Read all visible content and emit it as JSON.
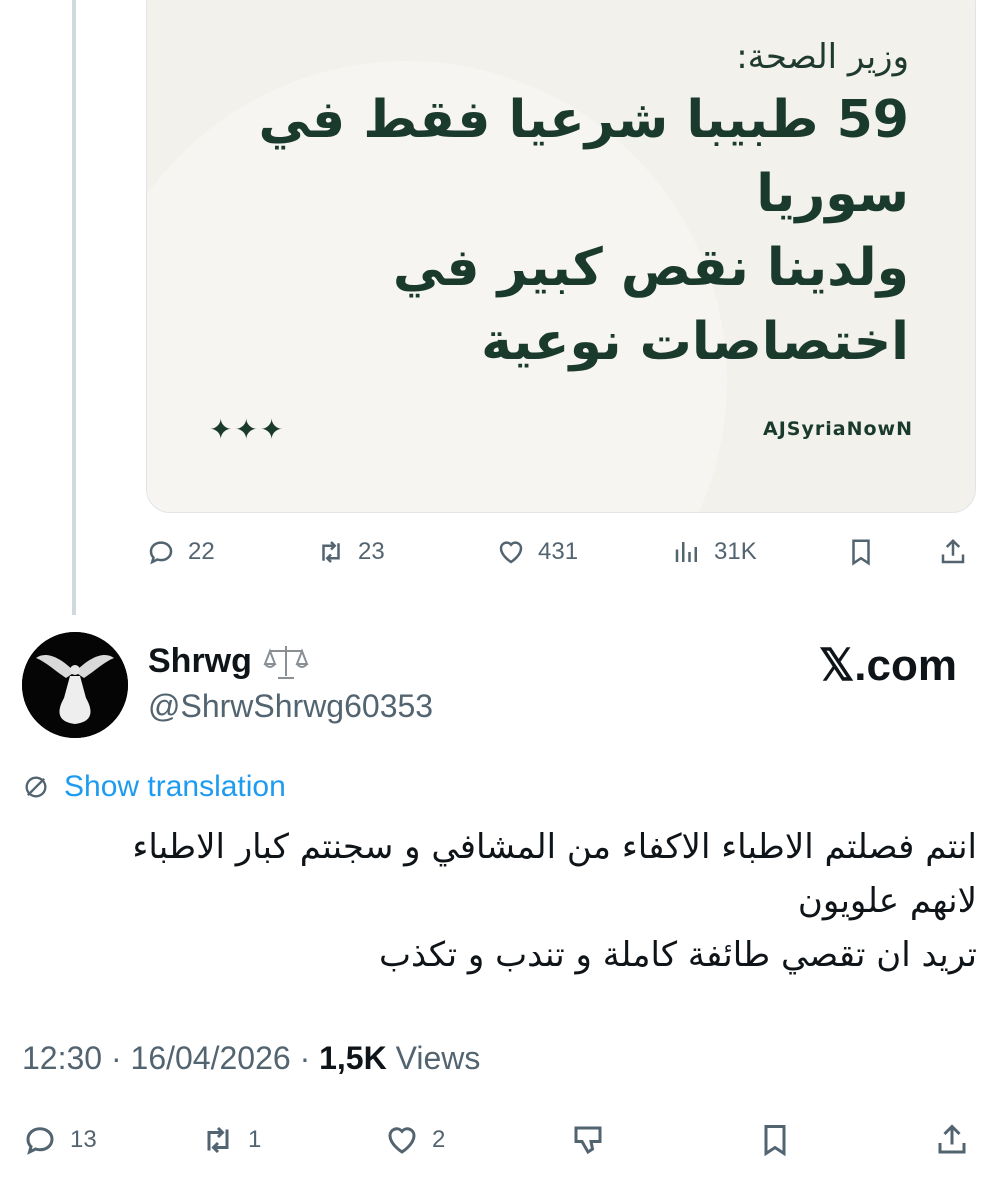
{
  "quoted_card": {
    "kicker": "وزير الصحة:",
    "headline_lines": [
      "59 طبيبا شرعيا فقط في سوريا",
      "ولدينا نقص كبير في",
      "اختصاصات نوعية"
    ],
    "stars": "✦✦✦",
    "brand": "AJSyriaNowN"
  },
  "parent_actions": {
    "replies": "22",
    "reposts": "23",
    "likes": "431",
    "views": "31K"
  },
  "author": {
    "display_name": "Shrwg",
    "badge_icon": "scales-icon",
    "handle": "@ShrwShrwg60353",
    "source_label": "𝕏.com"
  },
  "translation": {
    "label": "Show translation",
    "icon": "translate-icon",
    "link_color": "#1d9bf0"
  },
  "tweet": {
    "lines": [
      "انتم فصلتم الاطباء الاكفاء من المشافي و سجنتم كبار الاطباء",
      "لانهم علويون",
      "تريد ان تقصي طائفة كاملة و تندب و تكذب"
    ]
  },
  "meta": {
    "time": "12:30",
    "sep1": " · ",
    "date": "16/04/2026",
    "sep2": " · ",
    "views_count": "1,5K",
    "views_label": " Views"
  },
  "tweet_actions": {
    "replies": "13",
    "reposts": "1",
    "likes": "2"
  },
  "colors": {
    "muted": "#536471",
    "text": "#0f1419",
    "card_bg": "#f2f1ec",
    "card_text": "#1b3a2e"
  }
}
